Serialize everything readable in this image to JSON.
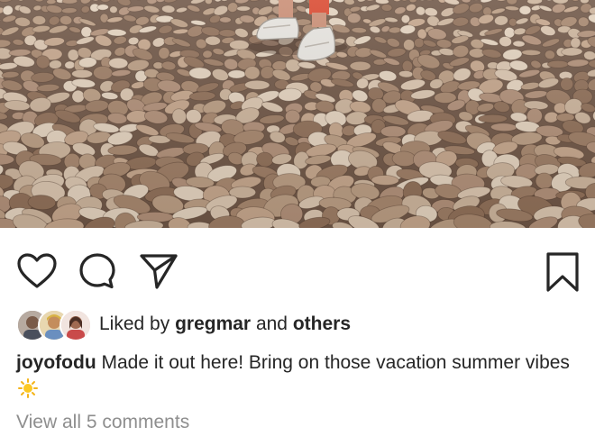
{
  "post": {
    "photo": {
      "subject": "pebble beach with feet in sneakers",
      "colors": {
        "base": "#b89a80",
        "stone_light": "#d8c3ad",
        "stone_mid": "#a9876c",
        "stone_dark": "#6f5646",
        "sneaker": "#e6e3de",
        "sock_red": "#d9482f"
      }
    },
    "actions": {
      "like_icon": "heart-icon",
      "comment_icon": "comment-icon",
      "share_icon": "share-icon",
      "save_icon": "bookmark-icon"
    },
    "likes": {
      "prefix": "Liked by",
      "user": "gregmar",
      "connector": "and",
      "others": "others"
    },
    "caption": {
      "username": "joyofodu",
      "text": "Made it out here! Bring on those vacation summer vibes",
      "emoji": "sun-emoji-icon"
    },
    "comments": {
      "view_all_label": "View all 5 comments"
    }
  }
}
